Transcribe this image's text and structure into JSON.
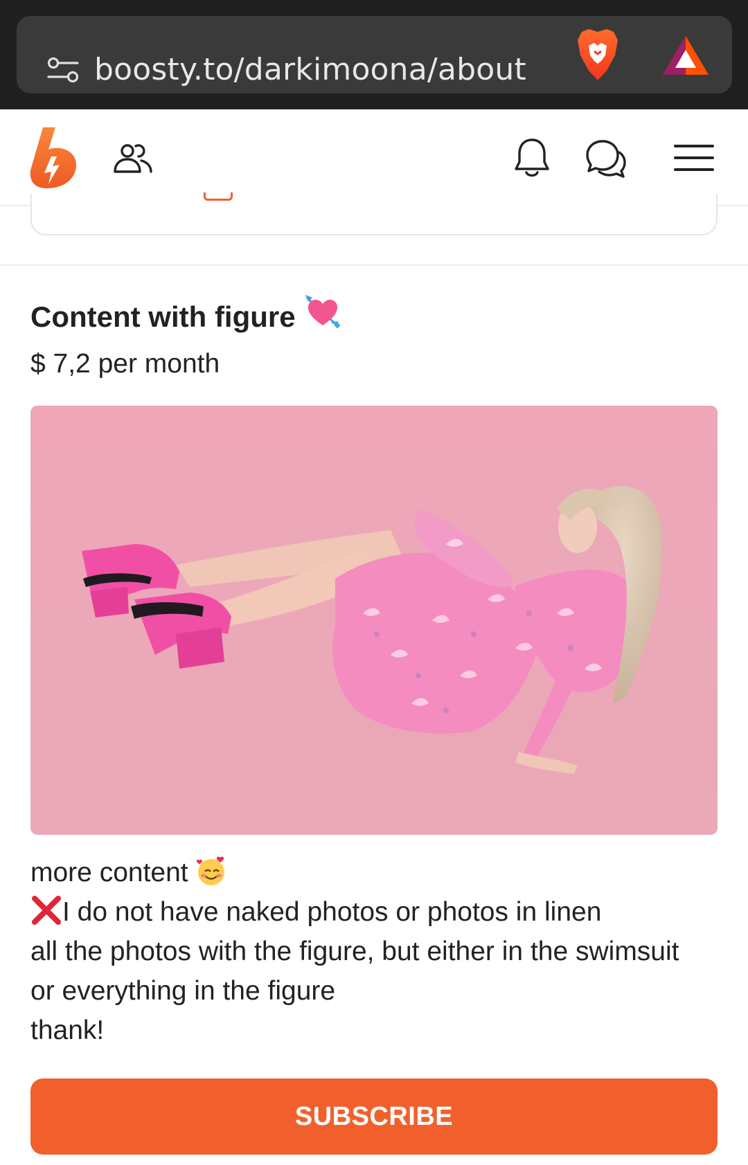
{
  "browser": {
    "url": "boosty.to/darkimoona/about"
  },
  "tier": {
    "title": "Content with figure",
    "title_emoji": "heart-with-arrow",
    "price": "$ 7,2 per month",
    "description": {
      "line1": "more content",
      "line1_emoji": "smiling-face-with-hearts",
      "line2_emoji": "cross-mark",
      "line2": "I do not have naked photos or photos in linen",
      "line3": "all the photos with the figure, but either in the swimsuit",
      "line4": "or everything in the figure",
      "line5": "thank!"
    },
    "subscribe_label": "SUBSCRIBE"
  },
  "colors": {
    "accent": "#f1602c",
    "browser_bg": "#1f1f1f",
    "url_pill": "#3a3a3a",
    "photo_bg": "#eba9b9"
  }
}
